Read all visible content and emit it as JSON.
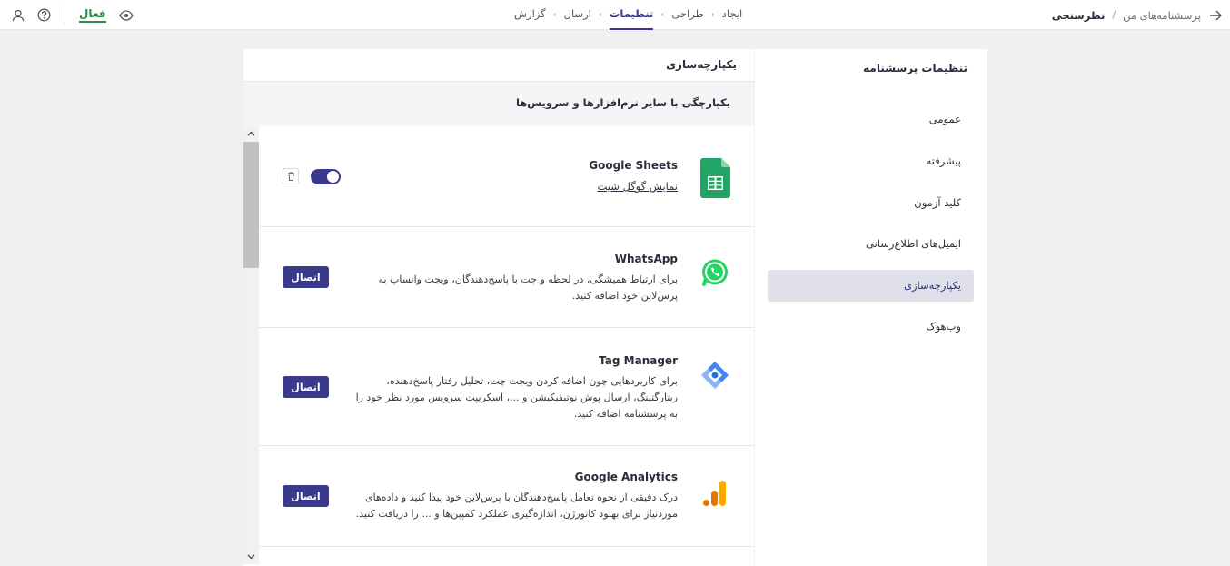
{
  "breadcrumb": {
    "parent": "پرسشنامه‌های من",
    "separator": "/",
    "current": "نظرسنجی"
  },
  "steps": [
    {
      "label": "ایجاد",
      "active": false
    },
    {
      "label": "طراحی",
      "active": false
    },
    {
      "label": "تنظیمات",
      "active": true
    },
    {
      "label": "ارسال",
      "active": false
    },
    {
      "label": "گزارش",
      "active": false
    }
  ],
  "step_separator": "›",
  "status": {
    "label": "فعال",
    "color": "#2d8a3e"
  },
  "icons": {
    "back": "arrow-right-icon",
    "preview": "eye-icon",
    "help": "help-circle-icon",
    "user": "user-icon"
  },
  "settings": {
    "title": "تنظیمات پرسشنامه",
    "items": [
      {
        "label": "عمومی",
        "active": false
      },
      {
        "label": "پیشرفته",
        "active": false
      },
      {
        "label": "کلید آزمون",
        "active": false
      },
      {
        "label": "ایمیل‌های اطلاع‌رسانی",
        "active": false
      },
      {
        "label": "یکپارچه‌سازی",
        "active": true
      },
      {
        "label": "وب‌هوک",
        "active": false
      }
    ]
  },
  "main": {
    "header": "یکپارچه‌سازی",
    "section_title": "یکپارچگی با سایر نرم‌افزارها و سرویس‌ها",
    "integrations": [
      {
        "name": "Google Sheets",
        "link": "نمایش گوگل شیت",
        "enabled": true,
        "icon": "google-sheets-icon"
      },
      {
        "name": "WhatsApp",
        "description": "برای ارتباط همیشگی، در لحظه و چت با پاسخ‌دهندگان، ویجت واتساپ به پرس‌لاین خود اضافه کنید.",
        "button": "اتصال",
        "icon": "whatsapp-icon"
      },
      {
        "name": "Tag Manager",
        "description": "برای کاربردهایی چون اضافه کردن ویجت چت، تحلیل رفتار پاسخ‌دهنده، ریتارگتینگ، ارسال پوش نوتیفیکیشن و ...، اسکریپت سرویس مورد نظر خود را به پرسشنامه اضافه کنید.",
        "button": "اتصال",
        "icon": "google-tag-manager-icon"
      },
      {
        "name": "Google Analytics",
        "description": "درک دقیقی از نحوه تعامل پاسخ‌دهندگان با پرس‌لاین خود پیدا کنید و داده‌های موردنیاز برای بهبود کانورژن، اندازه‌گیری عملکرد کمپین‌ها و ... را دریافت کنید.",
        "button": "اتصال",
        "icon": "google-analytics-icon"
      }
    ]
  },
  "colors": {
    "accent": "#3a3a8c",
    "active_nav_bg": "#e0e0ea",
    "success": "#2d8a3e"
  }
}
